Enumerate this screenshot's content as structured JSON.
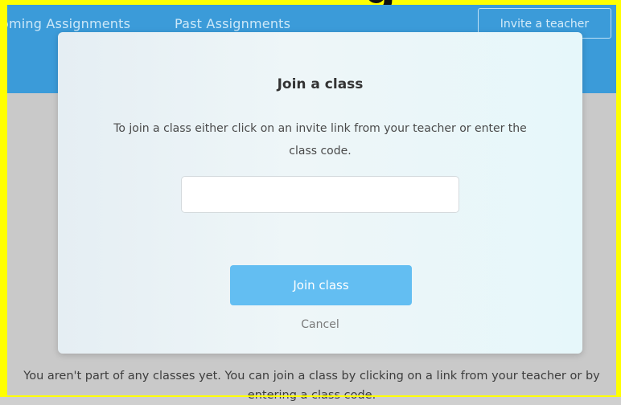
{
  "banner": {
    "glyph": "g"
  },
  "nav": {
    "upcoming_label": "oming Assignments",
    "past_label": "Past Assignments",
    "invite_label": "Invite a teacher"
  },
  "modal": {
    "title": "Join a class",
    "description": "To join a class either click on an invite link from your teacher or enter the class code.",
    "code_input_value": "",
    "join_label": "Join class",
    "cancel_label": "Cancel"
  },
  "empty_state": {
    "message": "You aren't part of any classes yet. You can join a class by clicking on a link from your teacher or by entering a class code."
  },
  "colors": {
    "frame": "#ffff00",
    "header": "#3b9bd9",
    "primary_button": "#63bef2"
  }
}
